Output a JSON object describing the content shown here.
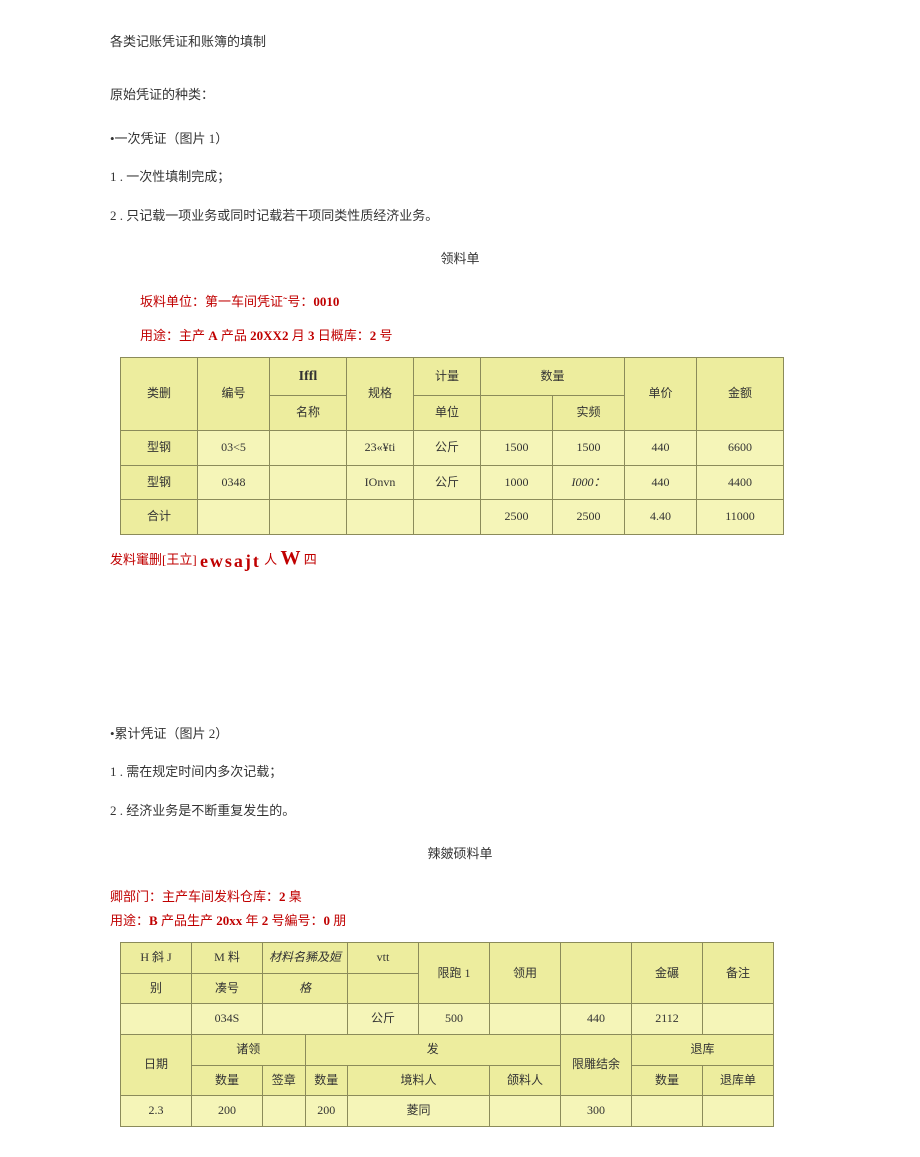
{
  "doc": {
    "main_title": "各类记账凭证和账簿的填制",
    "section1_heading": "原始凭证的种类：",
    "voucher1_bullet": "•一次凭证（图片 1）",
    "point1_1": "1 . 一次性填制完成；",
    "point1_2": "2 . 只记载一项业务或同时记载若干项同类性质经济业务。",
    "form1_title": "领料单",
    "form1_line1_a": "坂料单位：第一车间凭证˜号：",
    "form1_line1_b": "0010",
    "form1_line2_a": "用途：主产 ",
    "form1_line2_b": "A",
    "form1_line2_c": " 产品 ",
    "form1_line2_d": "20XX2",
    "form1_line2_e": " 月 ",
    "form1_line2_f": "3",
    "form1_line2_g": " 日概库：",
    "form1_line2_h": "2",
    "form1_line2_i": " 号",
    "sign_a": "发料竃删",
    "sign_b": "[王立]",
    "sign_c": "ewsajt",
    "sign_d": " 人 ",
    "sign_e": "W",
    "sign_f": " 四",
    "voucher2_bullet": "•累计凭证（图片 2）",
    "point2_1": "1 . 需在规定时间内多次记载；",
    "point2_2": "2 . 经济业务是不断重复发生的。",
    "form2_title": "辣皴硕料单",
    "form2_line1_a": "卿部门：主产车间发料仓库：",
    "form2_line1_b": "2",
    "form2_line1_c": " 臬",
    "form2_line2_a": "用途：",
    "form2_line2_b": "B",
    "form2_line2_c": " 产品生产 ",
    "form2_line2_d": "20xx",
    "form2_line2_e": " 年 ",
    "form2_line2_f": "2",
    "form2_line2_g": " 号編号：",
    "form2_line2_h": "0",
    "form2_line2_i": " 朋"
  },
  "table1": {
    "h_category": "类删",
    "h_number": "编号",
    "h_name_top": "Iffl",
    "h_name_bot": "名称",
    "h_spec": "规格",
    "h_measure": "计量",
    "h_unit": "单位",
    "h_qty": "数量",
    "h_actual": "实频",
    "h_price": "单价",
    "h_amount": "金额",
    "r1": {
      "cat": "型钢",
      "num": "03<5",
      "spec": "23«¥ti",
      "unit": "公斤",
      "q1": "1500",
      "q2": "1500",
      "price": "440",
      "amt": "6600"
    },
    "r2": {
      "cat": "型钢",
      "num": "0348",
      "spec": "IOnvn",
      "unit": "公斤",
      "q1": "1000",
      "q2": "I000：",
      "price": "440",
      "amt": "4400"
    },
    "r3": {
      "cat": "合计",
      "q1": "2500",
      "q2": "2500",
      "price": "4.40",
      "amt": "11000"
    }
  },
  "table2": {
    "h_hj": "H 斜 J",
    "h_bie": "别",
    "h_mliao": "M 料",
    "h_couhao": "凑号",
    "h_mat_name": "材料名豨及姮",
    "h_ge": "格",
    "h_vtt": "vtt",
    "h_xianpao": "限跑 1",
    "h_lingyong": "领用",
    "h_jinhuan": "金碾",
    "h_beizhu": "备注",
    "r1": {
      "num": "034S",
      "unit": "公斤",
      "limit": "500",
      "amt": "440",
      "note": "2112"
    },
    "h_riqi": "日期",
    "h_zhuling": "诸领",
    "h_fa": "发",
    "h_xiandiaojieyu": "限雕结余",
    "h_tuiku": "退库",
    "h_shuliang": "数量",
    "h_qianzhang": "签章",
    "h_jingliao": "境料人",
    "h_lingliao": "颌料人",
    "h_tuikudan": "退库单",
    "r2": {
      "date": "2.3",
      "q1": "200",
      "q2": "200",
      "jing": "菱同",
      "yu": "300"
    }
  }
}
